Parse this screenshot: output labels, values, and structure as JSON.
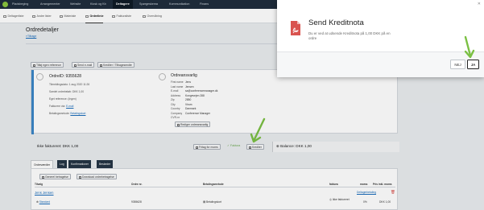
{
  "nav": {
    "items": [
      "Pladsbeging",
      "Arrangementer",
      "Website",
      "Kiosk og Kb",
      "Deltagere",
      "Spørgeskema",
      "Kommunikation",
      "Finans"
    ],
    "active_index": 4
  },
  "subnav": {
    "items": [
      "Deltagerliste",
      "Andre lister",
      "Materiale",
      "Ordrelinie",
      "Fakturaliste",
      "Overvåning"
    ],
    "active_index": 3
  },
  "page": {
    "title": "Ordredetaljer",
    "breadcrumb": "«Tilbage"
  },
  "toolbar": {
    "btn1": "Tilføj egen reference",
    "btn2": "Send e-mail",
    "btn3": "Krediter / Tilbagesendte"
  },
  "order": {
    "title": "OrdreID: 9355628",
    "rows": [
      "Tilmeldingsdato: 1 aug 2020 11:26",
      "Samlet ordrebeløb: DKK 1,00",
      "Eget reference: (Ingen)",
      "Fakturere via:",
      "Betalingsmetode:"
    ],
    "fakt_link": "E-mail",
    "bet_link": "Betalingskort"
  },
  "responsible": {
    "title": "Ordreansvarlig",
    "rows": [
      [
        "First name",
        "Jens"
      ],
      [
        "Last name",
        "Jensen"
      ],
      [
        "E-mail",
        "sa@conferencemanager.dk"
      ],
      [
        "Address",
        "Kongevejen 288"
      ],
      [
        "Zip",
        "2850"
      ],
      [
        "City",
        "Virum"
      ],
      [
        "Country",
        "Danmark"
      ],
      [
        "Company",
        "Conference Manager"
      ],
      [
        "CVR-nr",
        ""
      ]
    ],
    "edit_button": "Rediger ordreansvarlig"
  },
  "summary": {
    "left": "Ikke faktureret: DKK 1,00",
    "fritag": "Fritag for moms",
    "faktura": "Faktura",
    "krediter": "Krediter",
    "balance": "Balance: DKK 1,00"
  },
  "tabs": [
    "Ordreværdier",
    "Log",
    "Konfirmationer",
    "Beskeder"
  ],
  "panel": {
    "btn1": "Generel betragelse",
    "btn2": "Download ordrebetragelse",
    "headers": [
      "Tilvalg",
      "Ordre nr.",
      "Betalingsmetode",
      "faktura",
      "moms",
      "Pris inkl. moms"
    ],
    "group_name": "Jens Jensen",
    "group_link": "Deltagerbetaling",
    "row": [
      "Standard",
      "9355628",
      "Betalingskort",
      "Ikke faktureret",
      "0%",
      "DKK 1,00"
    ]
  },
  "modal": {
    "title": "Send Kreditnota",
    "body": "Du er ved at udsende Kreditnota på 1,00 DKK på en ordre",
    "no": "NEJ",
    "yes": "JA",
    "colors": {
      "icon": "#d9534f",
      "arrow": "#7bc043"
    }
  }
}
